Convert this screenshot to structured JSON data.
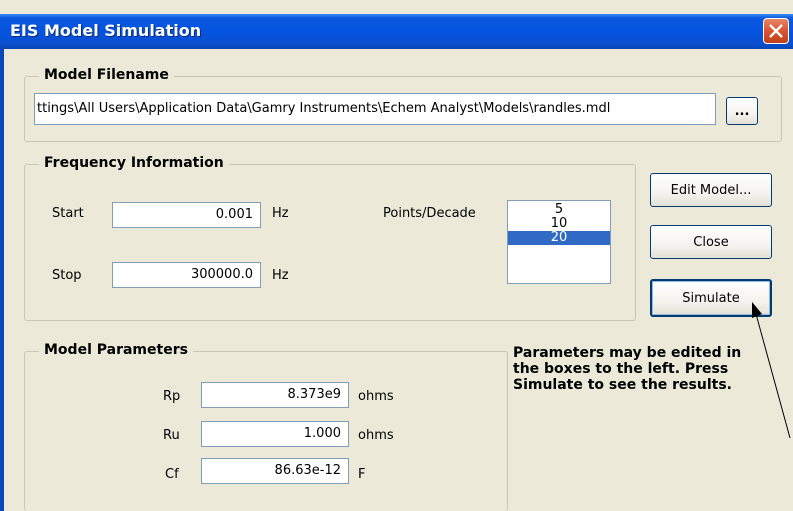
{
  "window": {
    "title": "EIS Model Simulation"
  },
  "model_filename": {
    "label": "Model Filename",
    "path": "ttings\\All Users\\Application Data\\Gamry Instruments\\Echem Analyst\\Models\\randles.mdl",
    "browse_label": "..."
  },
  "frequency": {
    "label": "Frequency Information",
    "start_label": "Start",
    "start_value": "0.001",
    "start_unit": "Hz",
    "stop_label": "Stop",
    "stop_value": "300000.0",
    "stop_unit": "Hz",
    "points_label": "Points/Decade",
    "points_options": [
      "5",
      "10",
      "20"
    ],
    "points_selected": "20"
  },
  "buttons": {
    "edit_model": "Edit Model...",
    "close": "Close",
    "simulate": "Simulate"
  },
  "parameters": {
    "label": "Model Parameters",
    "rp_label": "Rp",
    "rp_value": "8.373e9",
    "rp_unit": "ohms",
    "ru_label": "Ru",
    "ru_value": "1.000",
    "ru_unit": "ohms",
    "cf_label": "Cf",
    "cf_value": "86.63e-12",
    "cf_unit": "F"
  },
  "note": {
    "line1": "Parameters may be edited in",
    "line2": "the boxes to the left.  Press",
    "line3": "Simulate to see the results."
  },
  "colors": {
    "titlebar": "#0454e0",
    "selection": "#316ac5",
    "close": "#d9542e"
  }
}
